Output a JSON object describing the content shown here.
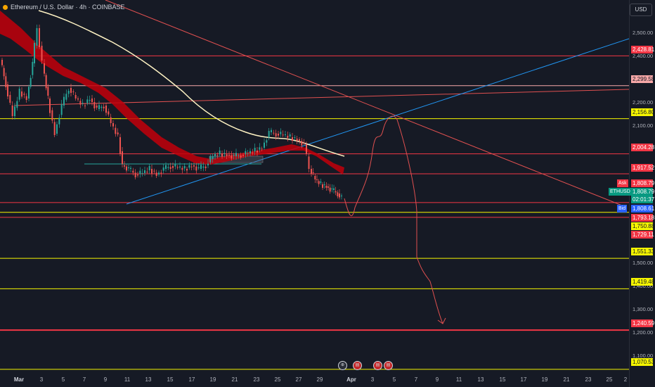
{
  "header": {
    "symbol_title": "Ethereum / U.S. Dollar · 4h · COINBASE",
    "currency_button": "USD",
    "live_indicator_color": "#f7a600"
  },
  "price_axis": {
    "ticks": [
      "2,500.00",
      "2,400.00",
      "2,200.00",
      "2,100.00",
      "1,500.00",
      "1,400.00",
      "1,300.00",
      "1,200.00",
      "1,100.00"
    ],
    "labels": [
      {
        "text": "2,428.81",
        "bg": "#f23645",
        "fg": "#ffffff"
      },
      {
        "text": "2,299.58",
        "bg": "#f7a8a8",
        "fg": "#131722"
      },
      {
        "text": "2,156.80",
        "bg": "#f5f500",
        "fg": "#131722"
      },
      {
        "text": "2,004.28",
        "bg": "#f23645",
        "fg": "#ffffff"
      },
      {
        "text": "1,917.52",
        "bg": "#f23645",
        "fg": "#ffffff"
      },
      {
        "text": "1,808.79",
        "bg": "#f23645",
        "fg": "#ffffff"
      },
      {
        "text": "1,808.79",
        "bg": "#089981",
        "fg": "#ffffff"
      },
      {
        "text": "02:01:37",
        "bg": "#089981",
        "fg": "#ffffff"
      },
      {
        "text": "1,808.61",
        "bg": "#2962ff",
        "fg": "#ffffff"
      },
      {
        "text": "1,793.18",
        "bg": "#f23645",
        "fg": "#ffffff"
      },
      {
        "text": "1,750.88",
        "bg": "#f5f500",
        "fg": "#131722"
      },
      {
        "text": "1,729.11",
        "bg": "#f23645",
        "fg": "#ffffff"
      },
      {
        "text": "1,551.33",
        "bg": "#f5f500",
        "fg": "#131722"
      },
      {
        "text": "1,419.48",
        "bg": "#f5f500",
        "fg": "#131722"
      },
      {
        "text": "1,240.59",
        "bg": "#f23645",
        "fg": "#ffffff"
      },
      {
        "text": "1,070.53",
        "bg": "#f5f500",
        "fg": "#131722"
      }
    ],
    "ask_tag": "Ask",
    "symbol_tag": "ETHUSD",
    "bid_tag": "Bid"
  },
  "time_axis": {
    "ticks": [
      "Mar",
      "3",
      "5",
      "7",
      "9",
      "11",
      "13",
      "15",
      "17",
      "19",
      "21",
      "23",
      "25",
      "27",
      "29",
      "Apr",
      "3",
      "5",
      "7",
      "9",
      "11",
      "13",
      "15",
      "17",
      "19",
      "21",
      "23",
      "25",
      "2"
    ]
  },
  "colors": {
    "background": "#161a25",
    "bull": "#26a69a",
    "bear": "#ef5350",
    "ribbon": "#d50000",
    "ma": "#fff3c4",
    "trend_blue": "#2196f3",
    "forecast": "#e05050"
  },
  "chart_data": {
    "type": "candlestick",
    "symbol": "ETHUSD",
    "interval": "4h",
    "exchange": "COINBASE",
    "ylim": [
      1060,
      2560
    ],
    "horizontal_levels": [
      {
        "value": 2428.81,
        "color": "#f23645"
      },
      {
        "value": 2299.58,
        "color": "#f7a8a8"
      },
      {
        "value": 2156.8,
        "color": "#f5f500"
      },
      {
        "value": 2004.28,
        "color": "#f23645"
      },
      {
        "value": 1917.52,
        "color": "#f23645"
      },
      {
        "value": 1793.18,
        "color": "#f23645"
      },
      {
        "value": 1750.88,
        "color": "#f5f500"
      },
      {
        "value": 1729.11,
        "color": "#f23645"
      },
      {
        "value": 1551.33,
        "color": "#f5f500"
      },
      {
        "value": 1419.48,
        "color": "#f5f500"
      },
      {
        "value": 1240.59,
        "color": "#f23645"
      },
      {
        "value": 1070.53,
        "color": "#f5f500"
      }
    ],
    "last_price": 1808.79,
    "countdown": "02:01:37"
  }
}
